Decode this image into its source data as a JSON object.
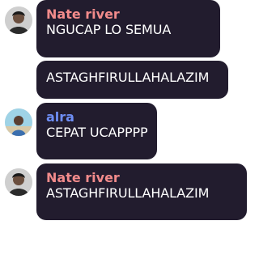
{
  "colors": {
    "bubble_bg": "#221c2e",
    "name_nate": "#f28b8b",
    "name_alra": "#6e8ef5",
    "message_text": "#ffffff"
  },
  "messages": [
    {
      "author": "Nate river",
      "avatar_icon": "user-avatar-nate-icon",
      "text": "NGUCAP LO SEMUA"
    },
    {
      "author": "",
      "text": "ASTAGHFIRULLAHALAZIM"
    },
    {
      "author": "alra",
      "avatar_icon": "user-avatar-alra-icon",
      "text": "CEPAT UCAPPPP"
    },
    {
      "author": "Nate river",
      "avatar_icon": "user-avatar-nate-icon",
      "text": "ASTAGHFIRULLAHALAZIM"
    }
  ]
}
